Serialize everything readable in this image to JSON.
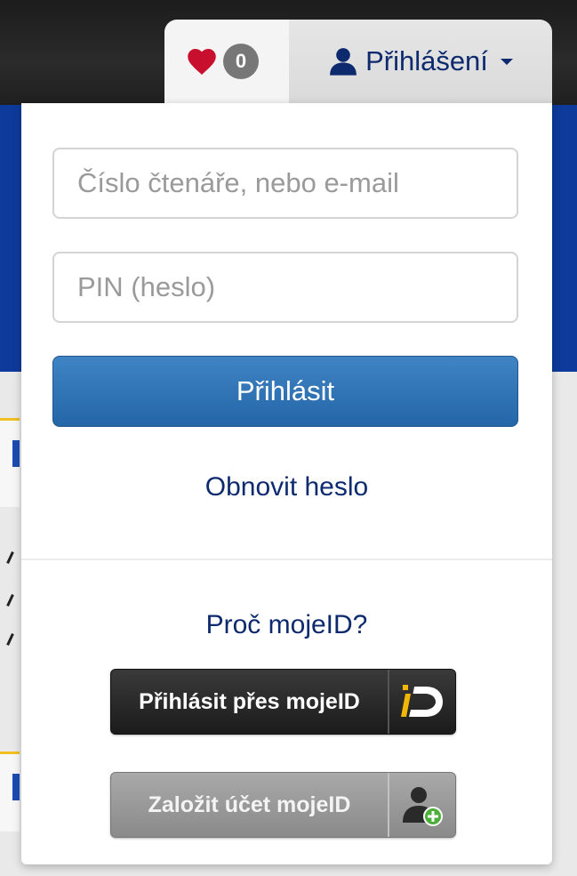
{
  "nav": {
    "favorites_count": "0",
    "login_label": "Přihlášení",
    "icons": {
      "favorites": "heart-icon",
      "user": "user-icon",
      "dropdown": "caret-down-icon"
    }
  },
  "login_form": {
    "username_placeholder": "Číslo čtenáře, nebo e-mail",
    "password_placeholder": "PIN (heslo)",
    "submit_label": "Přihlásit",
    "reset_password_link": "Obnovit heslo"
  },
  "mojeid": {
    "why_link": "Proč mojeID?",
    "login_button_label": "Přihlásit přes mojeID",
    "create_account_label": "Založit účet mojeID",
    "icons": {
      "login": "mojeid-logo-icon",
      "create": "add-user-icon"
    }
  },
  "colors": {
    "accent_blue": "#2466a8",
    "link_navy": "#0d2a6e",
    "heart_red": "#c8102e",
    "mojeid_yellow": "#f2b705"
  }
}
